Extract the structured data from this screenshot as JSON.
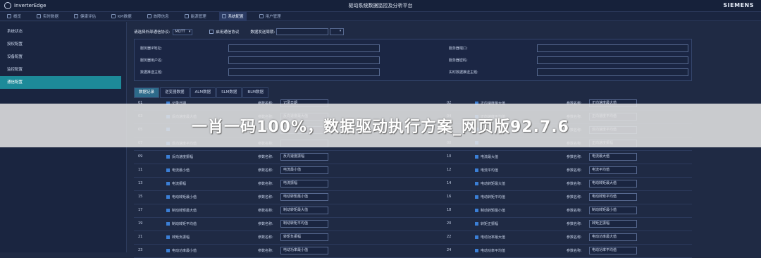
{
  "header": {
    "brand": "InverterEdge",
    "title": "驱动系统数据监控及分析平台",
    "company": "SIEMENS"
  },
  "nav_tabs": [
    {
      "label": "概览",
      "icon": "home-icon"
    },
    {
      "label": "实时数据",
      "icon": "chart-icon"
    },
    {
      "label": "健康评估",
      "icon": "heart-icon"
    },
    {
      "label": "KPI数据",
      "icon": "kpi-icon"
    },
    {
      "label": "故障信息",
      "icon": "alert-icon"
    },
    {
      "label": "能源管理",
      "icon": "energy-icon"
    },
    {
      "label": "系统配置",
      "icon": "gear-icon",
      "active": true
    },
    {
      "label": "用户管理",
      "icon": "user-icon"
    }
  ],
  "sidebar": {
    "items": [
      {
        "label": "系统状态"
      },
      {
        "label": "授权配置"
      },
      {
        "label": "设备配置"
      },
      {
        "label": "监控配置"
      },
      {
        "label": "通信配置",
        "active": true
      }
    ]
  },
  "protocol": {
    "select_label": "请选择外部通信协议:",
    "select_value": "MQTT",
    "enable_label": "启用通信协议",
    "interval_label": "数据发送周期:"
  },
  "settings": {
    "server_ip": "服务器IP地址:",
    "server_port": "服务器端口:",
    "server_user": "服务器用户名:",
    "server_password": "服务器密码:",
    "data_topic": "数据推送主题:",
    "realtime_topic": "实时数据推送主题:"
  },
  "data_tabs": [
    {
      "label": "数据记录",
      "active": true
    },
    {
      "label": "逆变器数据"
    },
    {
      "label": "ALM数据"
    },
    {
      "label": "SLM数据"
    },
    {
      "label": "BLM数据"
    }
  ],
  "param_label": "参数名称:",
  "rows": [
    {
      "left": {
        "no": "01",
        "name": "记录日期",
        "value": "记录日期"
      },
      "right": {
        "no": "02",
        "name": "正向速度最大值",
        "value": "正向速度最大值"
      }
    },
    {
      "left": {
        "no": "03",
        "name": "反向速度最大值",
        "value": "反向速度最大值"
      },
      "right": {
        "no": "04",
        "name": "正向速度平均值",
        "value": "正向速度平均值"
      }
    },
    {
      "left": {
        "no": "05",
        "name": "",
        "value": ""
      },
      "right": {
        "no": "06",
        "name": "",
        "value": "反向速度平均值"
      }
    },
    {
      "left": {
        "no": "07",
        "name": "反向速度平均值",
        "value": ""
      },
      "right": {
        "no": "08",
        "name": "",
        "value": "正向速度振幅"
      }
    },
    {
      "left": {
        "no": "09",
        "name": "反向速度振幅",
        "value": "反向速度振幅"
      },
      "right": {
        "no": "10",
        "name": "电流最大值",
        "value": "电流最大值"
      }
    },
    {
      "left": {
        "no": "11",
        "name": "电流最小值",
        "value": "电流最小值"
      },
      "right": {
        "no": "12",
        "name": "电流平均值",
        "value": "电流平均值"
      }
    },
    {
      "left": {
        "no": "13",
        "name": "电流振幅",
        "value": "电流振幅"
      },
      "right": {
        "no": "14",
        "name": "电动转矩最大值",
        "value": "电动转矩最大值"
      }
    },
    {
      "left": {
        "no": "15",
        "name": "电动转矩最小值",
        "value": "电动转矩最小值"
      },
      "right": {
        "no": "16",
        "name": "电动转矩平均值",
        "value": "电动转矩平均值"
      }
    },
    {
      "left": {
        "no": "17",
        "name": "制动转矩最大值",
        "value": "制动转矩最大值"
      },
      "right": {
        "no": "18",
        "name": "制动转矩最小值",
        "value": "制动转矩最小值"
      }
    },
    {
      "left": {
        "no": "19",
        "name": "制动转矩平均值",
        "value": "制动转矩平均值"
      },
      "right": {
        "no": "20",
        "name": "转矩正振幅",
        "value": "转矩正振幅"
      }
    },
    {
      "left": {
        "no": "21",
        "name": "转矩负振幅",
        "value": "转矩负振幅"
      },
      "right": {
        "no": "22",
        "name": "电动功率最大值",
        "value": "电动功率最大值"
      }
    },
    {
      "left": {
        "no": "23",
        "name": "电动功率最小值",
        "value": "电动功率最小值"
      },
      "right": {
        "no": "24",
        "name": "电动功率平均值",
        "value": "电动功率平均值"
      }
    }
  ],
  "overlay": {
    "text": "一肖一码100%，数据驱动执行方案_网页版92.7.6"
  }
}
